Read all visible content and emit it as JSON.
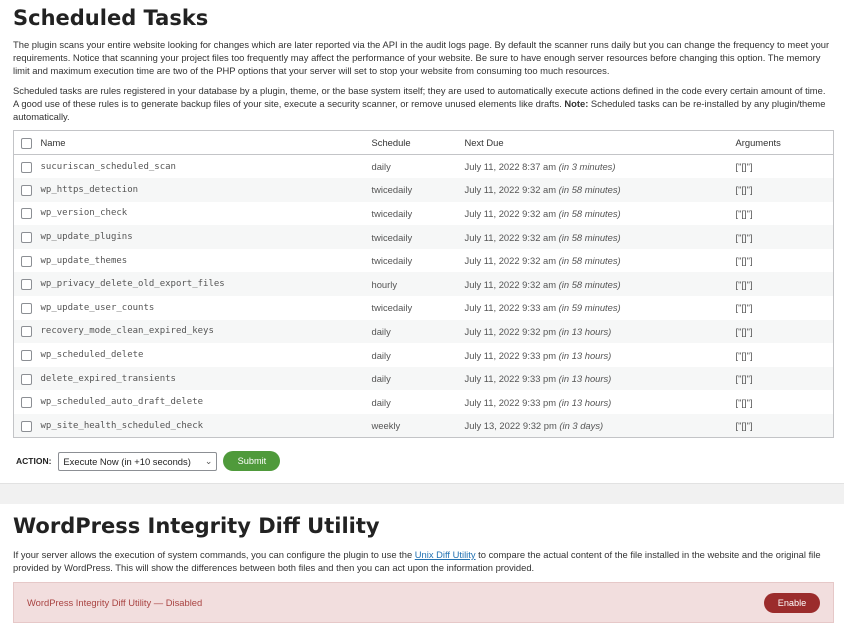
{
  "scheduled": {
    "title": "Scheduled Tasks",
    "desc1": "The plugin scans your entire website looking for changes which are later reported via the API in the audit logs page. By default the scanner runs daily but you can change the frequency to meet your requirements. Notice that scanning your project files too frequently may affect the performance of your website. Be sure to have enough server resources before changing this option. The memory limit and maximum execution time are two of the PHP options that your server will set to stop your website from consuming too much resources.",
    "desc2": "Scheduled tasks are rules registered in your database by a plugin, theme, or the base system itself; they are used to automatically execute actions defined in the code every certain amount of time. A good use of these rules is to generate backup files of your site, execute a security scanner, or remove unused elements like drafts.",
    "note_label": "Note:",
    "note_text": " Scheduled tasks can be re-installed by any plugin/theme automatically.",
    "columns": {
      "name": "Name",
      "schedule": "Schedule",
      "next_due": "Next Due",
      "arguments": "Arguments"
    },
    "rows": [
      {
        "name": "sucuriscan_scheduled_scan",
        "schedule": "daily",
        "due": "July 11, 2022 8:37 am",
        "rel": "(in 3 minutes)",
        "args": "[\"[]\"]"
      },
      {
        "name": "wp_https_detection",
        "schedule": "twicedaily",
        "due": "July 11, 2022 9:32 am",
        "rel": "(in 58 minutes)",
        "args": "[\"[]\"]"
      },
      {
        "name": "wp_version_check",
        "schedule": "twicedaily",
        "due": "July 11, 2022 9:32 am",
        "rel": "(in 58 minutes)",
        "args": "[\"[]\"]"
      },
      {
        "name": "wp_update_plugins",
        "schedule": "twicedaily",
        "due": "July 11, 2022 9:32 am",
        "rel": "(in 58 minutes)",
        "args": "[\"[]\"]"
      },
      {
        "name": "wp_update_themes",
        "schedule": "twicedaily",
        "due": "July 11, 2022 9:32 am",
        "rel": "(in 58 minutes)",
        "args": "[\"[]\"]"
      },
      {
        "name": "wp_privacy_delete_old_export_files",
        "schedule": "hourly",
        "due": "July 11, 2022 9:32 am",
        "rel": "(in 58 minutes)",
        "args": "[\"[]\"]"
      },
      {
        "name": "wp_update_user_counts",
        "schedule": "twicedaily",
        "due": "July 11, 2022 9:33 am",
        "rel": "(in 59 minutes)",
        "args": "[\"[]\"]"
      },
      {
        "name": "recovery_mode_clean_expired_keys",
        "schedule": "daily",
        "due": "July 11, 2022 9:32 pm",
        "rel": "(in 13 hours)",
        "args": "[\"[]\"]"
      },
      {
        "name": "wp_scheduled_delete",
        "schedule": "daily",
        "due": "July 11, 2022 9:33 pm",
        "rel": "(in 13 hours)",
        "args": "[\"[]\"]"
      },
      {
        "name": "delete_expired_transients",
        "schedule": "daily",
        "due": "July 11, 2022 9:33 pm",
        "rel": "(in 13 hours)",
        "args": "[\"[]\"]"
      },
      {
        "name": "wp_scheduled_auto_draft_delete",
        "schedule": "daily",
        "due": "July 11, 2022 9:33 pm",
        "rel": "(in 13 hours)",
        "args": "[\"[]\"]"
      },
      {
        "name": "wp_site_health_scheduled_check",
        "schedule": "weekly",
        "due": "July 13, 2022 9:32 pm",
        "rel": "(in 3 days)",
        "args": "[\"[]\"]"
      }
    ],
    "action_label": "ACTION:",
    "action_selected": "Execute Now (in +10 seconds)",
    "submit_label": "Submit"
  },
  "integrity": {
    "title": "WordPress Integrity Diff Utility",
    "desc_pre": "If your server allows the execution of system commands, you can configure the plugin to use the ",
    "desc_link": "Unix Diff Utility",
    "desc_post": " to compare the actual content of the file installed in the website and the original file provided by WordPress. This will show the differences between both files and then you can act upon the information provided.",
    "status_text": "WordPress Integrity Diff Utility — Disabled",
    "enable_label": "Enable"
  },
  "colors": {
    "submit_green": "#4f9a3b",
    "enable_red": "#9b2c2c",
    "notice_bg": "#f2dede",
    "link_blue": "#2271b1"
  }
}
